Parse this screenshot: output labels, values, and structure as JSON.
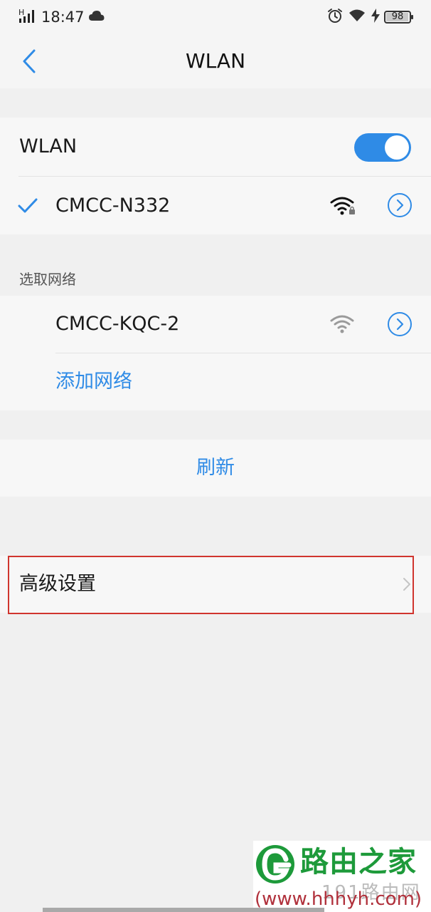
{
  "status_bar": {
    "network_label": "H",
    "time": "18:47",
    "battery": 98,
    "battery_label": "98",
    "icons": [
      "signal-icon",
      "cloud-icon",
      "alarm-icon",
      "wifi-icon",
      "charging-icon",
      "battery-icon"
    ]
  },
  "header": {
    "title": "WLAN",
    "back_icon": "chevron-left-icon"
  },
  "wlan_toggle": {
    "label": "WLAN",
    "enabled": true
  },
  "connected_network": {
    "name": "CMCC-N332",
    "secured": true,
    "connected": true
  },
  "choose_network": {
    "section_label": "选取网络",
    "networks": [
      {
        "name": "CMCC-KQC-2",
        "secured": false
      }
    ],
    "add_network_label": "添加网络"
  },
  "refresh": {
    "label": "刷新"
  },
  "advanced": {
    "label": "高级设置"
  },
  "watermark": {
    "title": "路由之家",
    "sub": "191路由网",
    "url": "(www.hhhyh.com)"
  },
  "colors": {
    "accent": "#2f8be6",
    "highlight": "#d0352e",
    "background": "#f0f0f0",
    "card": "#f7f7f7"
  }
}
